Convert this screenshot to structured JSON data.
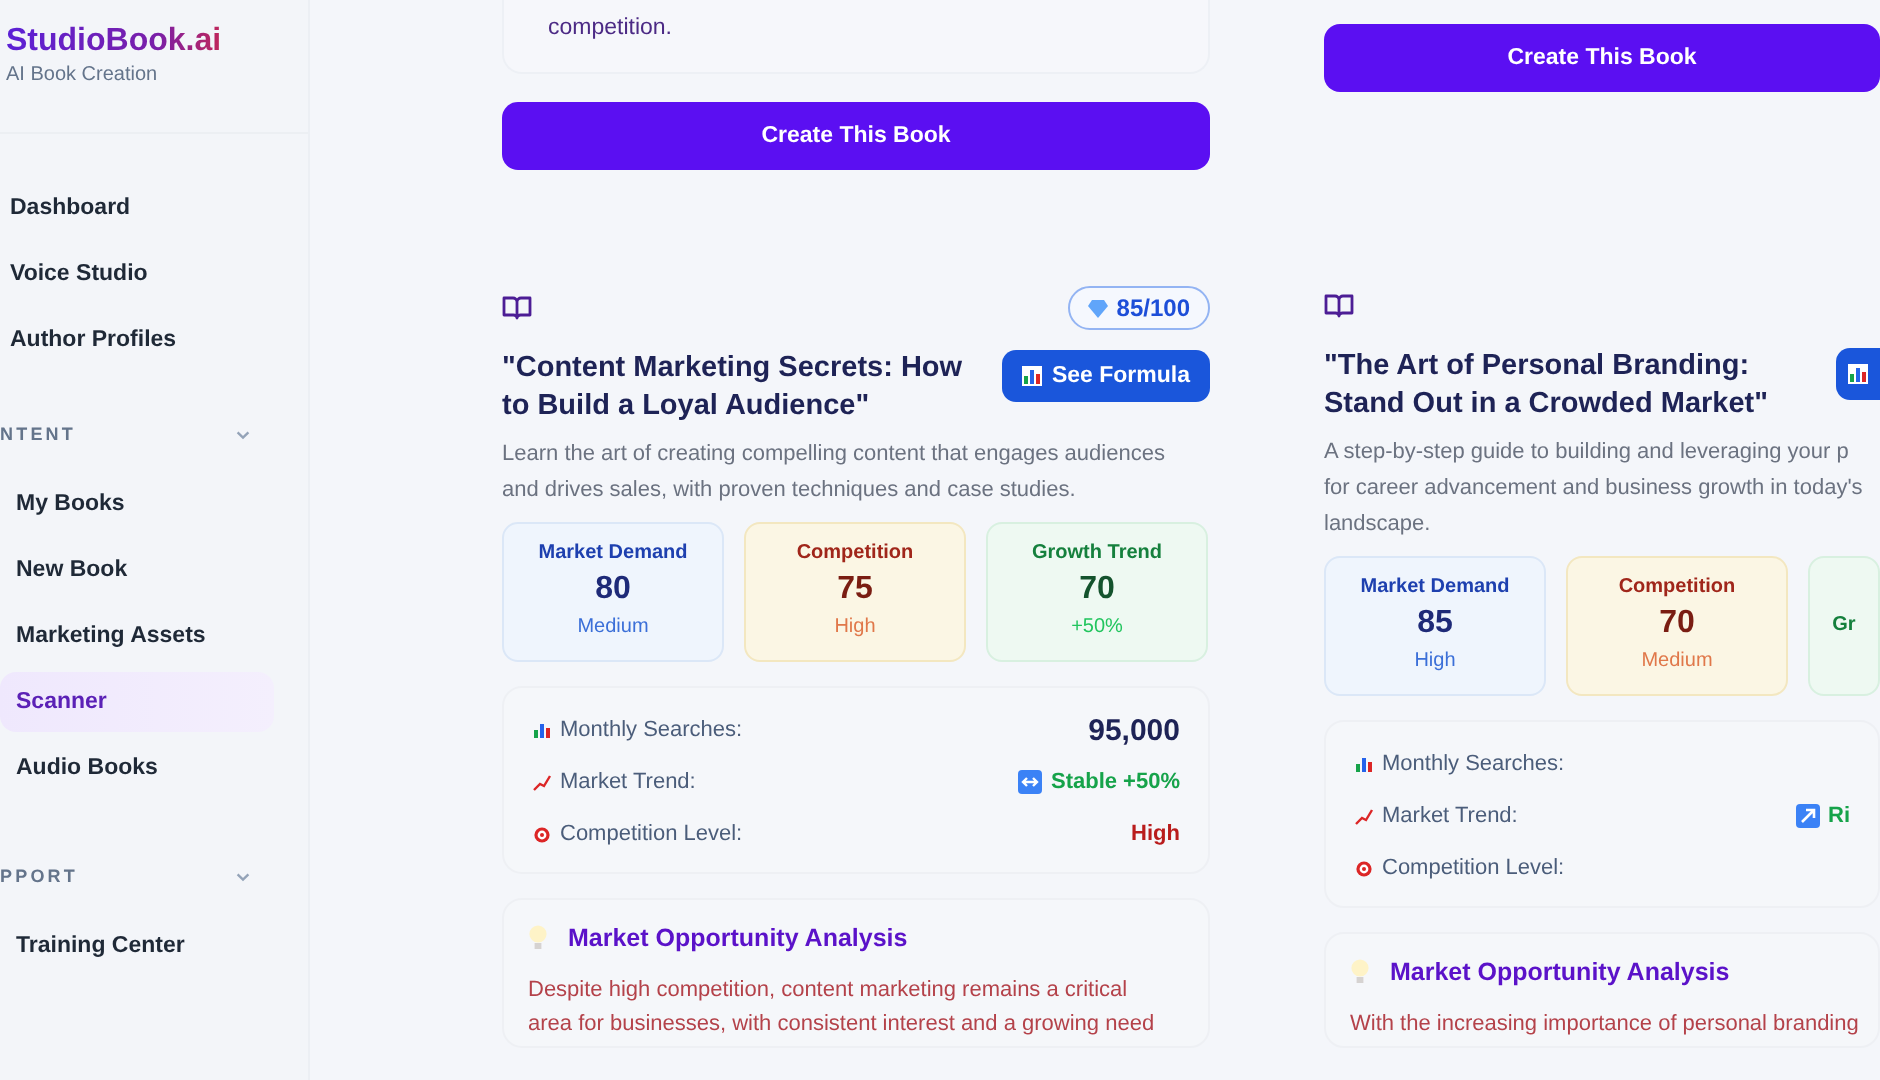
{
  "brand": {
    "name": "StudioBook.ai",
    "tagline": "AI Book Creation"
  },
  "sidebar": {
    "items": [
      {
        "label": "Dashboard",
        "selected": false
      },
      {
        "label": "Voice Studio",
        "selected": false
      },
      {
        "label": "Author Profiles",
        "selected": false
      }
    ],
    "sections": [
      {
        "title": "NTENT",
        "expanded": true,
        "items": [
          {
            "label": "My Books",
            "selected": false
          },
          {
            "label": "New Book",
            "selected": false
          },
          {
            "label": "Marketing Assets",
            "selected": false
          },
          {
            "label": "Scanner",
            "selected": true
          },
          {
            "label": "Audio Books",
            "selected": false
          }
        ]
      },
      {
        "title": "PPORT",
        "expanded": true,
        "items": [
          {
            "label": "Training Center",
            "selected": false
          }
        ]
      }
    ]
  },
  "columns": [
    {
      "previous_card": {
        "text": "competition.",
        "create_button": "Create This Book"
      },
      "card": {
        "score": "85/100",
        "title": "\"Content Marketing Secrets: How to Build a Loyal Audience\"",
        "formula_button": {
          "label": "See Formula"
        },
        "description_lines": [
          "Learn the art of creating compelling content that engages audiences",
          "and drives sales, with proven techniques and case studies."
        ],
        "metrics": [
          {
            "kind": "demand",
            "label": "Market Demand",
            "value": "80",
            "note": "Medium"
          },
          {
            "kind": "competition",
            "label": "Competition",
            "value": "75",
            "note": "High"
          },
          {
            "kind": "growth",
            "label": "Growth Trend",
            "value": "70",
            "note": "+50%"
          }
        ],
        "stats": [
          {
            "kind": "searches",
            "label": "Monthly Searches:",
            "value": "95,000"
          },
          {
            "kind": "trend-stable",
            "label": "Market Trend:",
            "value": "Stable +50%"
          },
          {
            "kind": "competition",
            "label": "Competition Level:",
            "value": "High"
          }
        ],
        "analysis": {
          "title": "Market Opportunity Analysis",
          "text_lines": [
            "Despite high competition, content marketing remains a critical",
            "area for businesses, with consistent interest and a growing need"
          ]
        }
      }
    },
    {
      "previous_card": {
        "create_button": "Create This Book"
      },
      "card": {
        "title": "\"The Art of Personal Branding: Stand Out in a Crowded Market\"",
        "formula_button": {
          "label_shown": false
        },
        "description_lines": [
          "A step-by-step guide to building and leveraging your p",
          "for career advancement and business growth in today's",
          "landscape."
        ],
        "metrics": [
          {
            "kind": "demand",
            "label": "Market Demand",
            "value": "85",
            "note": "High"
          },
          {
            "kind": "competition",
            "label": "Competition",
            "value": "70",
            "note": "Medium"
          },
          {
            "kind": "growth",
            "label": "Gr"
          }
        ],
        "stats": [
          {
            "kind": "searches",
            "label": "Monthly Searches:"
          },
          {
            "kind": "trend-rising",
            "label": "Market Trend:",
            "value": "Ri"
          },
          {
            "kind": "competition",
            "label": "Competition Level:"
          }
        ],
        "analysis": {
          "title": "Market Opportunity Analysis",
          "text_lines": [
            "With the increasing importance of personal branding"
          ]
        }
      }
    }
  ]
}
